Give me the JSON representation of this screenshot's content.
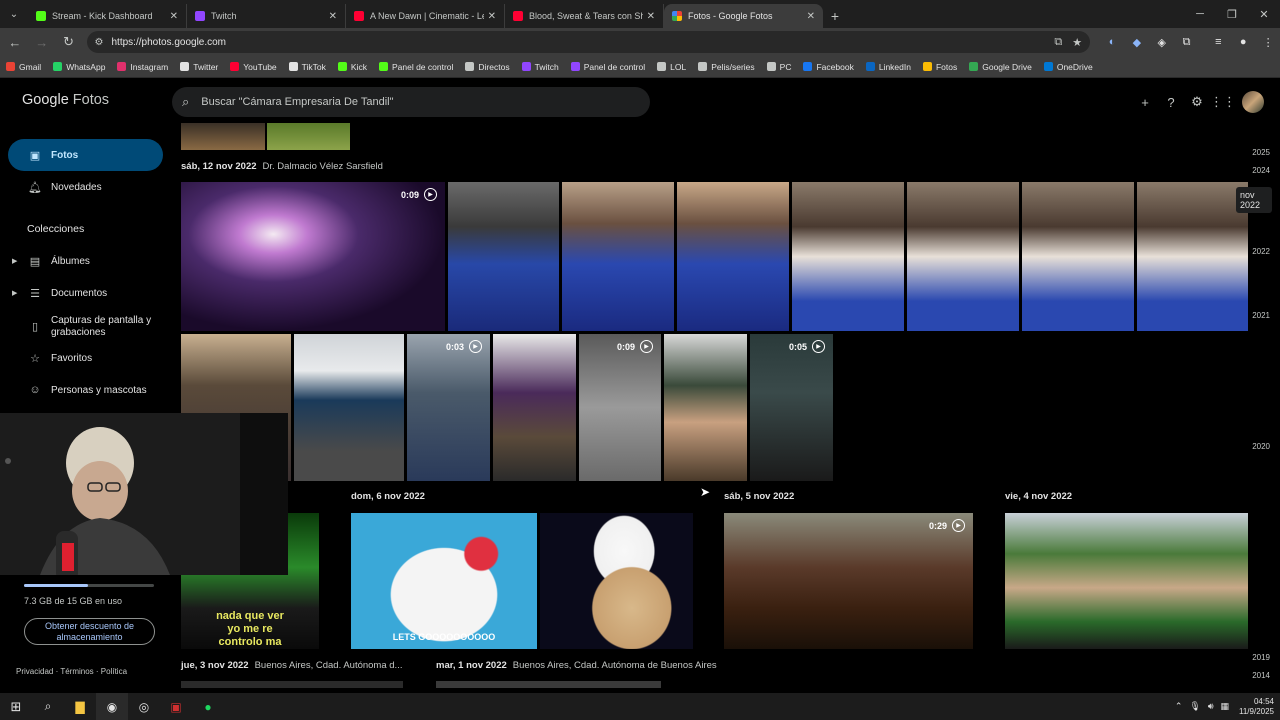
{
  "browser": {
    "tabs": [
      {
        "title": "Stream - Kick Dashboard",
        "color": "#53fc18"
      },
      {
        "title": "Twitch",
        "color": "#9146ff"
      },
      {
        "title": "A New Dawn | Cinematic - Leag",
        "color": "#ff0033"
      },
      {
        "title": "Blood, Sweat & Tears con Sher",
        "color": "#ff0033"
      },
      {
        "title": "Fotos - Google Fotos",
        "color": "#fbbc04"
      }
    ],
    "url": "https://photos.google.com",
    "bookmarks": [
      {
        "label": "Gmail",
        "color": "#ea4335"
      },
      {
        "label": "WhatsApp",
        "color": "#25d366"
      },
      {
        "label": "Instagram",
        "color": "#e1306c"
      },
      {
        "label": "Twitter",
        "color": "#e3e3e3"
      },
      {
        "label": "YouTube",
        "color": "#ff0033"
      },
      {
        "label": "TikTok",
        "color": "#e3e3e3"
      },
      {
        "label": "Kick",
        "color": "#53fc18"
      },
      {
        "label": "Panel de control",
        "color": "#53fc18"
      },
      {
        "label": "Directos",
        "color": "#c4c7c5"
      },
      {
        "label": "Twitch",
        "color": "#9146ff"
      },
      {
        "label": "Panel de control",
        "color": "#9146ff"
      },
      {
        "label": "LOL",
        "color": "#c4c7c5"
      },
      {
        "label": "Pelis/series",
        "color": "#c4c7c5"
      },
      {
        "label": "PC",
        "color": "#c4c7c5"
      },
      {
        "label": "Facebook",
        "color": "#1877f2"
      },
      {
        "label": "LinkedIn",
        "color": "#0a66c2"
      },
      {
        "label": "Fotos",
        "color": "#fbbc04"
      },
      {
        "label": "Google Drive",
        "color": "#34a853"
      },
      {
        "label": "OneDrive",
        "color": "#0078d4"
      }
    ]
  },
  "header": {
    "brand_google": "Google",
    "brand_fotos": "Fotos",
    "search_placeholder": "Buscar \"Cámara Empresaria De Tandil\""
  },
  "sidebar": {
    "fotos": "Fotos",
    "novedades": "Novedades",
    "colecciones": "Colecciones",
    "albumes": "Álbumes",
    "documentos": "Documentos",
    "capturas": "Capturas de pantalla y grabaciones",
    "favoritos": "Favoritos",
    "personas": "Personas y mascotas",
    "storage_text": "7.3 GB de 15 GB en uso",
    "storage_fraction": 0.49,
    "storage_button": "Obtener descuento de almacenamiento",
    "privacy": "Privacidad",
    "terms": "Términos",
    "policy": "Política"
  },
  "groups": {
    "g1_date": "sáb, 12 nov 2022",
    "g1_loc": "Dr. Dalmacio Vélez Sarsfield",
    "g2_date": "dom, 6 nov 2022",
    "g3_date": "sáb, 5 nov 2022",
    "g4_date": "vie, 4 nov 2022",
    "g5_date": "jue, 3 nov 2022",
    "g5_loc": "Buenos Aires, Cdad. Autónoma d...",
    "g6_date": "mar, 1 nov 2022",
    "g6_loc": "Buenos Aires, Cdad. Autónoma de Buenos Aires"
  },
  "videos": {
    "v1": "0:09",
    "v2": "0:03",
    "v3": "0:09",
    "v4": "0:05",
    "v5": "0:29"
  },
  "memes": {
    "m1_line1": "nada que ver",
    "m1_line2": "yo me re",
    "m1_line3": "controlo ma",
    "m2": "LETS GOOOOOOOOOO"
  },
  "timeline": {
    "y2025": "2025",
    "y2024": "2024",
    "current": "nov 2022",
    "y2022": "2022",
    "y2021": "2021",
    "y2020": "2020",
    "y2019": "2019",
    "y2014": "2014"
  },
  "taskbar": {
    "time": "04:54",
    "date": "11/9/2025"
  }
}
